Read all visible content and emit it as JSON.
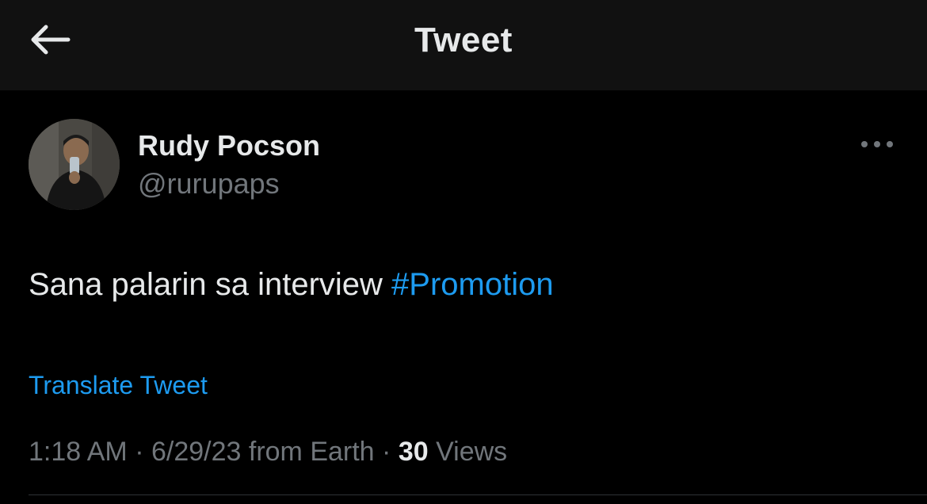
{
  "header": {
    "title": "Tweet",
    "back_icon": "arrow-left-icon"
  },
  "tweet": {
    "author": {
      "display_name": "Rudy Pocson",
      "handle": "@rurupaps",
      "avatar_icon": "profile-photo"
    },
    "more_icon": "ellipsis-icon",
    "text": "Sana palarin sa interview ",
    "hashtag": "#Promotion",
    "translate_label": "Translate Tweet",
    "meta": {
      "time": "1:18 AM",
      "sep1": " · ",
      "date": "6/29/23",
      "source": " from Earth",
      "sep2": " · ",
      "views_count": "30",
      "views_label": " Views"
    }
  },
  "colors": {
    "background": "#000000",
    "header_background": "#111111",
    "primary_text": "#e7e9ea",
    "secondary_text": "#71767b",
    "accent": "#1d9bf0",
    "divider": "#2f3336"
  }
}
